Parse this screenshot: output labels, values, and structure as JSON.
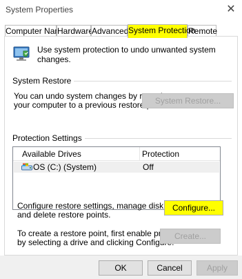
{
  "window": {
    "title": "System Properties",
    "close_glyph": "✕"
  },
  "tabs": [
    {
      "label": "Computer Name",
      "active": false
    },
    {
      "label": "Hardware",
      "active": false
    },
    {
      "label": "Advanced",
      "active": false
    },
    {
      "label": "System Protection",
      "active": true
    },
    {
      "label": "Remote",
      "active": false
    }
  ],
  "intro": {
    "icon": "shield-computer-icon",
    "text": "Use system protection to undo unwanted system changes."
  },
  "system_restore": {
    "heading": "System Restore",
    "description_line1": "You can undo system changes by reverting",
    "description_line2": "your computer to a previous restore point.",
    "button_label": "System Restore..."
  },
  "protection_settings": {
    "heading": "Protection Settings",
    "columns": [
      "Available Drives",
      "Protection"
    ],
    "drives": [
      {
        "icon": "drive-icon",
        "name": "OS (C:) (System)",
        "protection": "Off"
      }
    ],
    "configure": {
      "line1": "Configure restore settings, manage disk space,",
      "line2": "and delete restore points.",
      "button_label": "Configure..."
    },
    "create": {
      "line1": "To create a restore point, first enable protection",
      "line2": "by selecting a drive and clicking Configure.",
      "button_label": "Create..."
    }
  },
  "footer": {
    "ok_label": "OK",
    "cancel_label": "Cancel",
    "apply_label": "Apply"
  },
  "colors": {
    "highlight": "#ffff00",
    "disabled_text": "#a0a0a0",
    "button_face": "#e1e1e1"
  }
}
